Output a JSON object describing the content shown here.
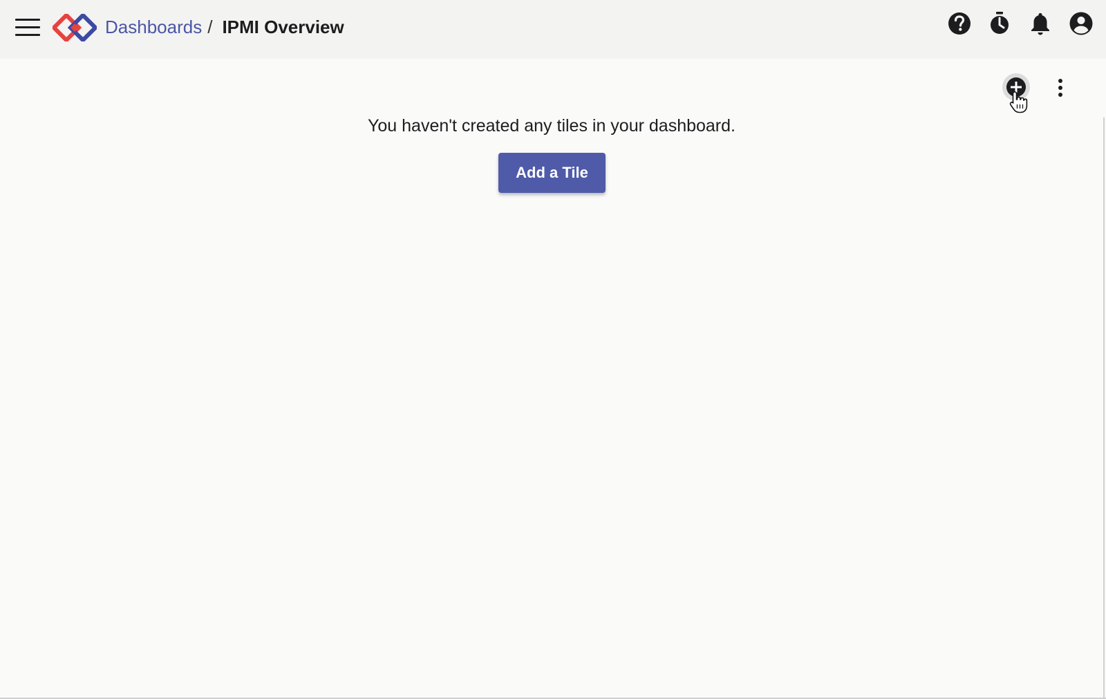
{
  "header": {
    "breadcrumb": {
      "parent_label": "Dashboards",
      "separator": "/",
      "current_label": "IPMI Overview"
    },
    "icons": [
      "menu-icon",
      "logo-icon",
      "help-icon",
      "timer-icon",
      "bell-icon",
      "account-icon"
    ]
  },
  "toolbar": {
    "icons": [
      "add-circle-icon",
      "more-vert-icon"
    ]
  },
  "empty_state": {
    "message": "You haven't created any tiles in your dashboard.",
    "button_label": "Add a Tile"
  },
  "colors": {
    "accent": "#4f5ba9",
    "link": "#4a56a6",
    "logo_red": "#e8423f",
    "logo_blue": "#3d4aa3",
    "icon": "#1d1d1f"
  }
}
